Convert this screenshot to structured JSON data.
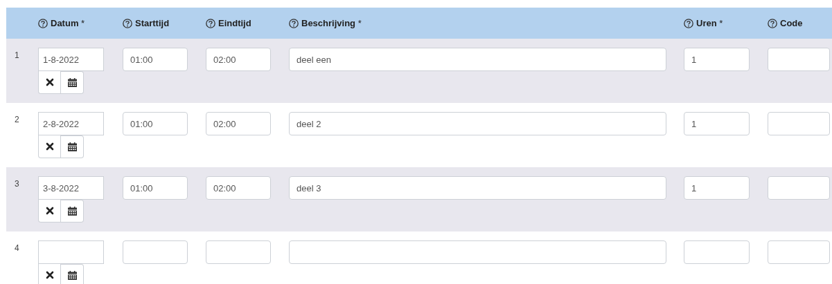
{
  "columns": [
    {
      "label": "**Datum** *"
    },
    {
      "label": "**Starttijd**"
    },
    {
      "label": "**Eindtijd**"
    },
    {
      "label": "**Beschrijving** *"
    },
    {
      "label": "**Uren** *"
    },
    {
      "label": "**Code**"
    }
  ],
  "rows": [
    {
      "number": "1",
      "date": "1-8-2022",
      "start": "01:00",
      "end": "02:00",
      "description": "deel een",
      "hours": "1"
    },
    {
      "number": "2",
      "date": "2-8-2022",
      "start": "01:00",
      "end": "02:00",
      "description": "deel 2",
      "hours": "1"
    },
    {
      "number": "3",
      "date": "3-8-2022",
      "start": "01:00",
      "end": "02:00",
      "description": "deel 3",
      "hours": "1"
    },
    {
      "number": "4"
    }
  ]
}
